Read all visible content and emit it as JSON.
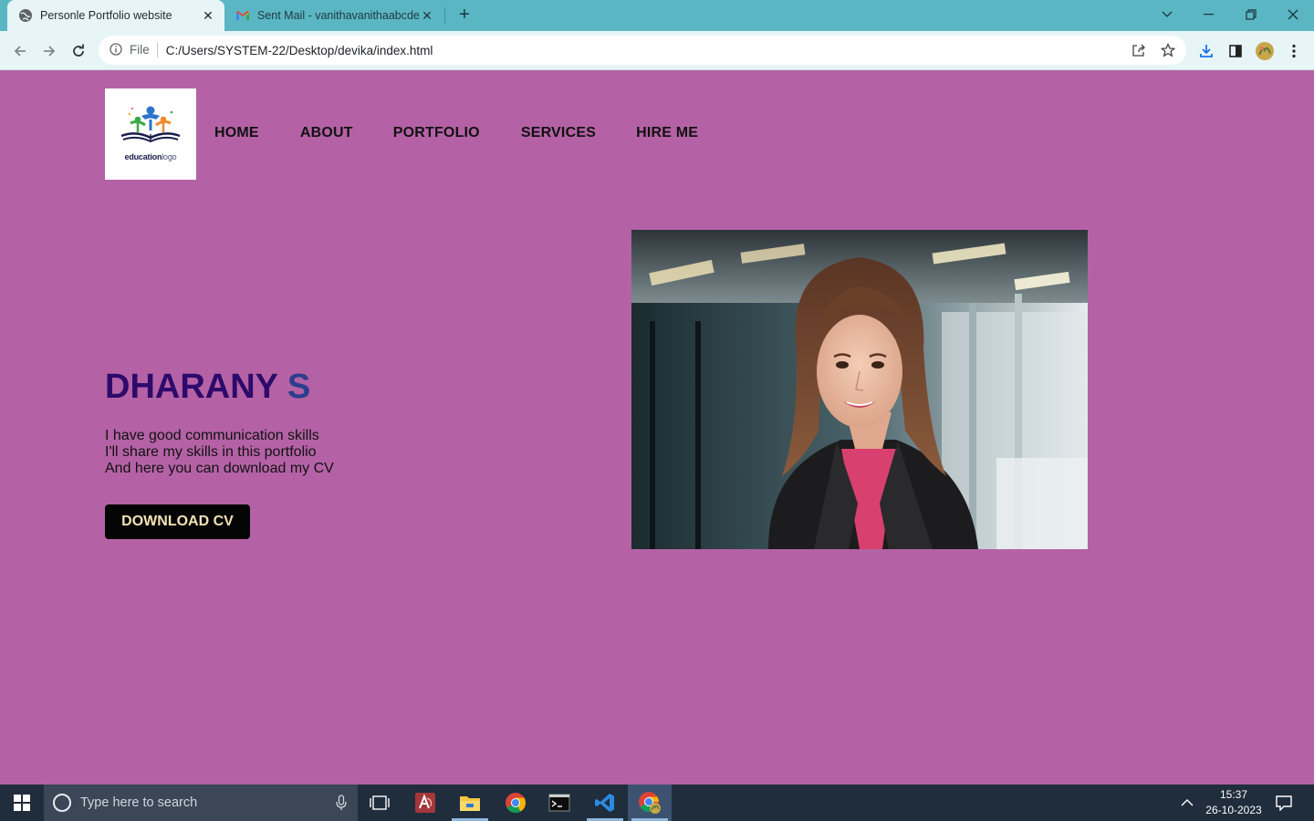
{
  "browser": {
    "tabs": [
      {
        "title": "Personle Portfolio website",
        "active": true
      },
      {
        "title": "Sent Mail - vanithavanithaabcde",
        "active": false
      }
    ],
    "address": {
      "scheme_label": "File",
      "url": "C:/Users/SYSTEM-22/Desktop/devika/index.html"
    }
  },
  "site": {
    "logo": {
      "bold": "education",
      "light": "logo"
    },
    "nav": [
      "HOME",
      "ABOUT",
      "PORTFOLIO",
      "SERVICES",
      "HIRE ME"
    ],
    "hero": {
      "first_name": "DHARANY",
      "last_name": "S",
      "bio_lines": [
        "I have good communication skills",
        "I'll share my skills in this portfolio",
        "And here you can download my CV"
      ],
      "cta": "DOWNLOAD CV"
    }
  },
  "taskbar": {
    "search_placeholder": "Type here to search",
    "time": "15:37",
    "date": "26-10-2023"
  },
  "colors": {
    "page_bg": "#b462a5",
    "tab_strip": "#5bb6c3",
    "name_color": "#2d0a6b",
    "cta_bg": "#050505",
    "cta_text": "#f4e3b5"
  }
}
